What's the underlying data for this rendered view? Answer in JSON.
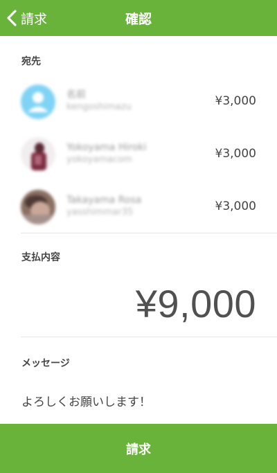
{
  "header": {
    "back_label": "請求",
    "title": "確認",
    "accent_color": "#6ab33b"
  },
  "recipients_section": {
    "label": "宛先",
    "items": [
      {
        "name": "名前",
        "id": "kengoshimazu",
        "amount": "¥3,000",
        "avatar": "default-user-avatar"
      },
      {
        "name": "Yokoyama Hiroki",
        "id": "yokoyamacom",
        "amount": "¥3,000",
        "avatar": "photo-avatar"
      },
      {
        "name": "Takayama Rosa",
        "id": "yasshimmar35",
        "amount": "¥3,000",
        "avatar": "photo-avatar"
      }
    ]
  },
  "payment_section": {
    "label": "支払内容",
    "total": "¥9,000"
  },
  "message_section": {
    "label": "メッセージ",
    "text": "よろしくお願いします！"
  },
  "footer": {
    "submit_label": "請求"
  }
}
